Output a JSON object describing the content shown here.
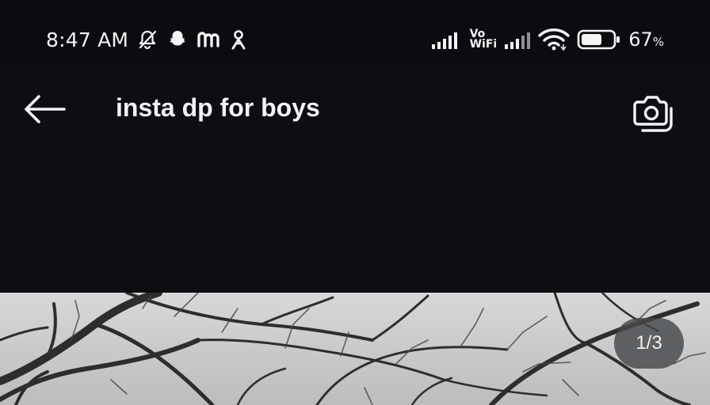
{
  "status_bar": {
    "time": "8:47 AM",
    "notification_icons": [
      "bell-muted-icon",
      "snapchat-icon",
      "m-app-icon",
      "person-app-icon"
    ],
    "volte_top": "Vo",
    "volte_bottom": "WiFi",
    "battery_percent": "67",
    "battery_unit": "%",
    "battery_level": 0.67
  },
  "header": {
    "search_query": "insta dp for boys",
    "back_icon": "arrow-left-icon",
    "camera_icon": "camera-search-icon"
  },
  "image_viewer": {
    "page_indicator": "1/3"
  },
  "colors": {
    "background": "#0c0e12",
    "text": "#f2f3f5",
    "badge": "#46484a"
  }
}
